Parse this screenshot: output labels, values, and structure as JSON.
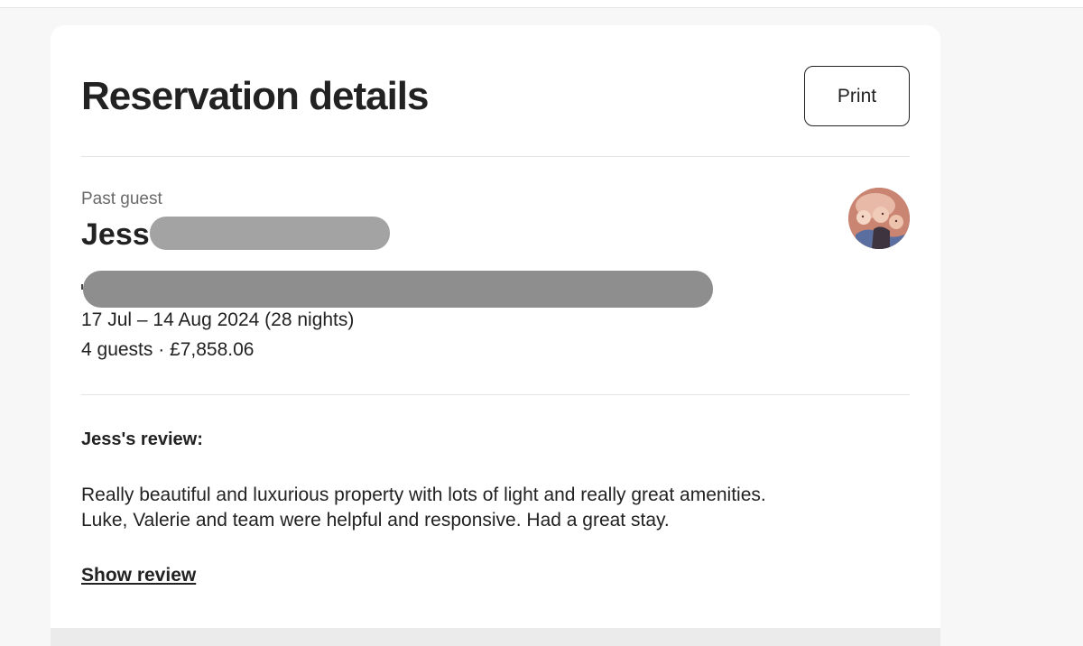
{
  "page": {
    "title": "Reservation details",
    "print_label": "Print"
  },
  "guest": {
    "status": "Past guest",
    "name": "Jess",
    "dates": "17 Jul – 14 Aug 2024 (28 nights)",
    "guests_price": "4 guests · £7,858.06"
  },
  "review": {
    "heading": "Jess's review:",
    "line1": "Really beautiful and luxurious property with lots of light and really great amenities.",
    "line2": "Luke, Valerie and team were helpful and responsive. Had a great stay.",
    "show_label": "Show review"
  },
  "colors": {
    "text": "#222222",
    "muted": "#6a6a6a",
    "divider": "#e4e4e4",
    "redaction": "#a3a3a3",
    "background": "#f7f7f7"
  }
}
